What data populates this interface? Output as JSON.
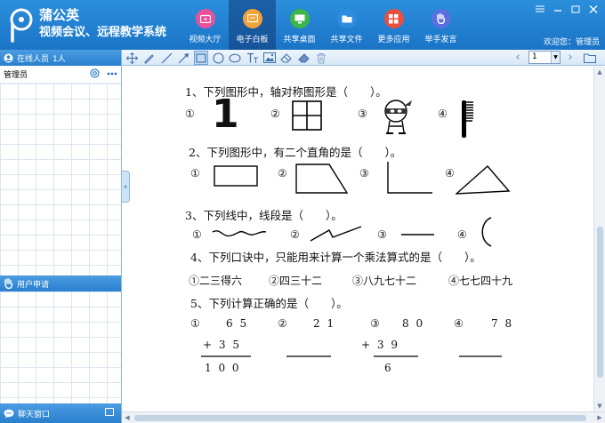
{
  "app": {
    "brand_line1": "蒲公英",
    "brand_line2": "视频会议、远程教学系统",
    "welcome": "欢迎您：管理员"
  },
  "nav": [
    {
      "label": "视频大厅",
      "icon": "tv-icon",
      "color": "#e9529a"
    },
    {
      "label": "电子白板",
      "icon": "whiteboard-icon",
      "color": "#f3a23a",
      "active": true
    },
    {
      "label": "共享桌面",
      "icon": "monitor-icon",
      "color": "#3cb54a"
    },
    {
      "label": "共享文件",
      "icon": "folder-icon",
      "color": "#2d8be0"
    },
    {
      "label": "更多应用",
      "icon": "apps-icon",
      "color": "#e94f3d"
    },
    {
      "label": "举手发言",
      "icon": "raise-hand-icon",
      "color": "#5b6fe0"
    }
  ],
  "left_panel": {
    "online_label": "在线人员",
    "online_count": "1人",
    "user_name": "管理员",
    "apply_label": "用户申请",
    "chat_label": "聊天窗口"
  },
  "toolbar": {
    "page_value": "1"
  },
  "exercise": {
    "q1": "1、下列图形中，轴对称图形是（　　）。",
    "q1_opts": [
      "①",
      "②",
      "③",
      "④"
    ],
    "q1_digit": "1",
    "q2": "2、下列图形中，有二个直角的是（　　）。",
    "q2_opts": [
      "①",
      "②",
      "③",
      "④"
    ],
    "q3": "3、下列线中，线段是（　　）。",
    "q3_opts": [
      "①",
      "②",
      "③",
      "④"
    ],
    "q4": "4、下列口诀中，只能用来计算一个乘法算式的是（　　）。",
    "q4_opts": [
      "①二三得六",
      "②四三十二",
      "③八九七十二",
      "④七七四十九"
    ],
    "q5": "5、下列计算正确的是（　　）。",
    "q5_opts": [
      "①",
      "②",
      "③",
      "④"
    ],
    "q5_a_top": "6 5",
    "q5_a_add": "+ 3 5",
    "q5_a_res": "1 0 0",
    "q5_b_top": "2 1",
    "q5_c_top": "8 0",
    "q5_c_add": "+ 3 9",
    "q5_c_res": "6",
    "q5_d_top": "7 8"
  }
}
